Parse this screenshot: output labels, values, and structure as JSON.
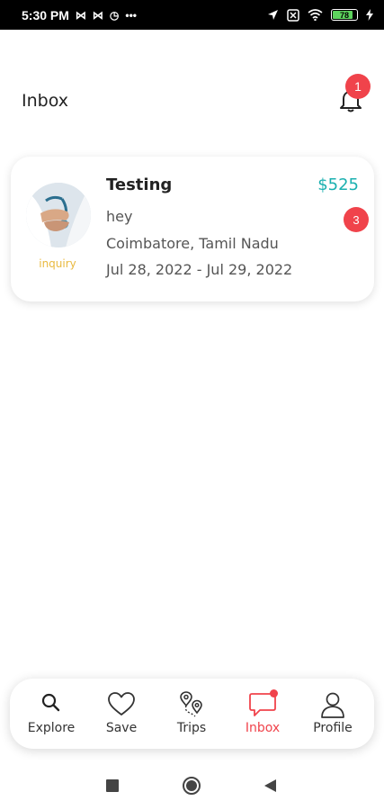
{
  "status_bar": {
    "time": "5:30 PM",
    "battery_level": "78",
    "icons": [
      "gmail-icon",
      "gmail-icon",
      "sync-icon",
      "more-dots-icon",
      "location-icon",
      "sim-icon",
      "wifi-icon",
      "battery-icon",
      "charging-icon"
    ]
  },
  "header": {
    "title": "Inbox",
    "notification_count": "1"
  },
  "inbox": {
    "items": [
      {
        "title": "Testing",
        "price": "$525",
        "message": "hey",
        "location": "Coimbatore, Tamil Nadu",
        "dates": "Jul 28, 2022 - Jul 29, 2022",
        "status": "inquiry",
        "unread_count": "3"
      }
    ]
  },
  "bottom_nav": {
    "items": [
      {
        "label": "Explore",
        "icon": "search-icon"
      },
      {
        "label": "Save",
        "icon": "heart-icon"
      },
      {
        "label": "Trips",
        "icon": "map-pins-icon"
      },
      {
        "label": "Inbox",
        "icon": "chat-icon",
        "active": true
      },
      {
        "label": "Profile",
        "icon": "person-icon"
      }
    ]
  },
  "colors": {
    "accent": "#f0434b",
    "price": "#1ab0b0",
    "status_inquiry": "#e9b93f"
  }
}
